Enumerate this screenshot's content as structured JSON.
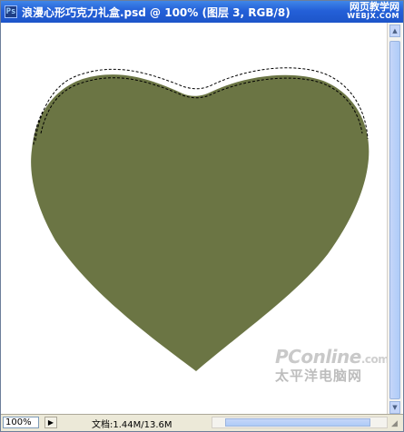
{
  "titlebar": {
    "title": "浪漫心形巧克力礼盒.psd @ 100% (图层 3, RGB/8)",
    "app_icon": "photoshop-document-icon"
  },
  "watermark_top": {
    "line1": "网页教学网",
    "line2": "WEBJX.COM"
  },
  "canvas": {
    "shape_color": "#6b7544",
    "background": "#ffffff",
    "icons": [
      "heart-shape-icon",
      "marquee-selection-icon"
    ]
  },
  "watermark_bottom": {
    "brand": "PConline",
    "domain": ".com.cn",
    "sub": "太平洋电脑网"
  },
  "statusbar": {
    "zoom": "100%",
    "doc_info": "文档:1.44M/13.6M"
  }
}
